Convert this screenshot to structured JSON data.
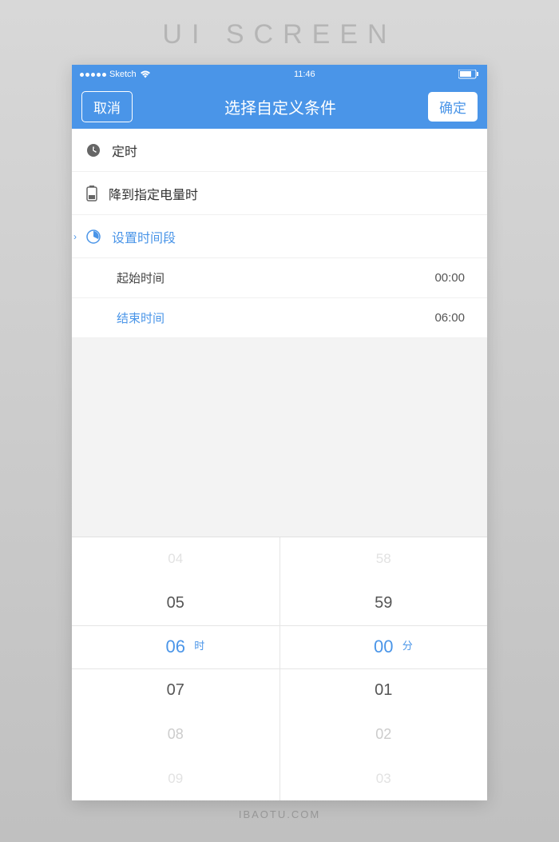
{
  "outer": {
    "title": "UI SCREEN",
    "footer": "IBAOTU.COM"
  },
  "status": {
    "carrier": "Sketch",
    "time": "11:46"
  },
  "nav": {
    "cancel": "取消",
    "title": "选择自定义条件",
    "confirm": "确定"
  },
  "options": {
    "timer": "定时",
    "battery": "降到指定电量时",
    "period": "设置时间段"
  },
  "times": {
    "start_label": "起始时间",
    "start_value": "00:00",
    "end_label": "结束时间",
    "end_value": "06:00"
  },
  "picker": {
    "hour": {
      "unit": "时",
      "items": [
        "04",
        "05",
        "06",
        "07",
        "08",
        "09"
      ]
    },
    "minute": {
      "unit": "分",
      "items": [
        "58",
        "59",
        "00",
        "01",
        "02",
        "03"
      ]
    }
  },
  "colors": {
    "accent": "#4a95e8"
  }
}
